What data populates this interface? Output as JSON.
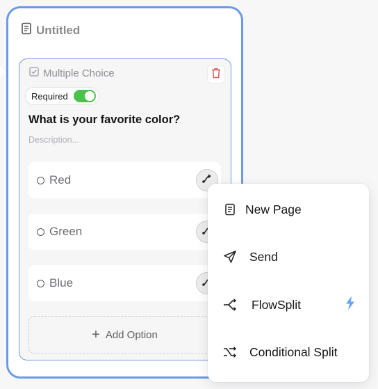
{
  "page": {
    "title": "Untitled",
    "icon": "document-icon"
  },
  "question": {
    "type_label": "Multiple Choice",
    "type_icon": "checkbox-icon",
    "required_label": "Required",
    "required": true,
    "text": "What is your favorite color?",
    "description_placeholder": "Description...",
    "options": [
      {
        "label": "Red"
      },
      {
        "label": "Green"
      },
      {
        "label": "Blue"
      }
    ],
    "add_option_label": "Add Option"
  },
  "flow_menu": {
    "items": [
      {
        "label": "New Page",
        "icon": "document-icon"
      },
      {
        "label": "Send",
        "icon": "send-icon"
      },
      {
        "label": "FlowSplit",
        "icon": "split-icon",
        "badge": "lightning-icon"
      },
      {
        "label": "Conditional Split",
        "icon": "conditional-split-icon"
      }
    ]
  },
  "colors": {
    "accent_border": "#6b9ae6",
    "toggle_on": "#4cc24c",
    "delete_red": "#e05555",
    "bolt_blue": "#6aa3f5"
  }
}
